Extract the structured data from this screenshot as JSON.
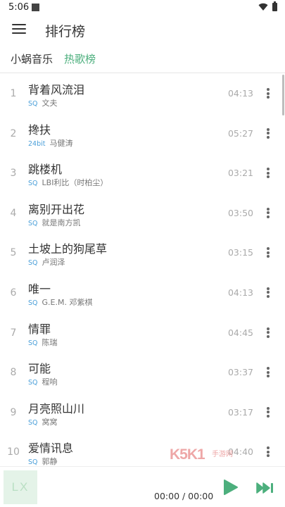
{
  "status_bar": {
    "time": "5:06"
  },
  "app_bar": {
    "title": "排行榜"
  },
  "tabs": {
    "source": "小蜗音乐",
    "list": "热歌榜"
  },
  "colors": {
    "accent": "#4caf7d",
    "quality": "#4a9fd9",
    "text": "#333333",
    "muted": "#aaaaaa"
  },
  "songs": [
    {
      "index": "1",
      "name": "背着风流泪",
      "quality": "SQ",
      "artist": "文夫",
      "duration": "04:13"
    },
    {
      "index": "2",
      "name": "搀扶",
      "quality": "24bit",
      "artist": "马健涛",
      "duration": "05:27"
    },
    {
      "index": "3",
      "name": "跳楼机",
      "quality": "SQ",
      "artist": "LBI利比（时柏尘）",
      "duration": "03:21"
    },
    {
      "index": "4",
      "name": "离别开出花",
      "quality": "SQ",
      "artist": "就是南方凯",
      "duration": "03:50"
    },
    {
      "index": "5",
      "name": "土坡上的狗尾草",
      "quality": "SQ",
      "artist": "卢润泽",
      "duration": "03:15"
    },
    {
      "index": "6",
      "name": "唯一",
      "quality": "SQ",
      "artist": "G.E.M. 邓紫棋",
      "duration": "04:13"
    },
    {
      "index": "7",
      "name": "情罪",
      "quality": "SQ",
      "artist": "陈瑞",
      "duration": "04:45"
    },
    {
      "index": "8",
      "name": "可能",
      "quality": "SQ",
      "artist": "程响",
      "duration": "03:37"
    },
    {
      "index": "9",
      "name": "月亮照山川",
      "quality": "SQ",
      "artist": "窝窝",
      "duration": "03:17"
    },
    {
      "index": "10",
      "name": "爱情讯息",
      "quality": "SQ",
      "artist": "郭静",
      "duration": "04:40"
    }
  ],
  "player": {
    "album_placeholder": "LX",
    "time": "00:00 / 00:00"
  },
  "watermark": {
    "text": "K5K1",
    "sub": "手游网"
  }
}
